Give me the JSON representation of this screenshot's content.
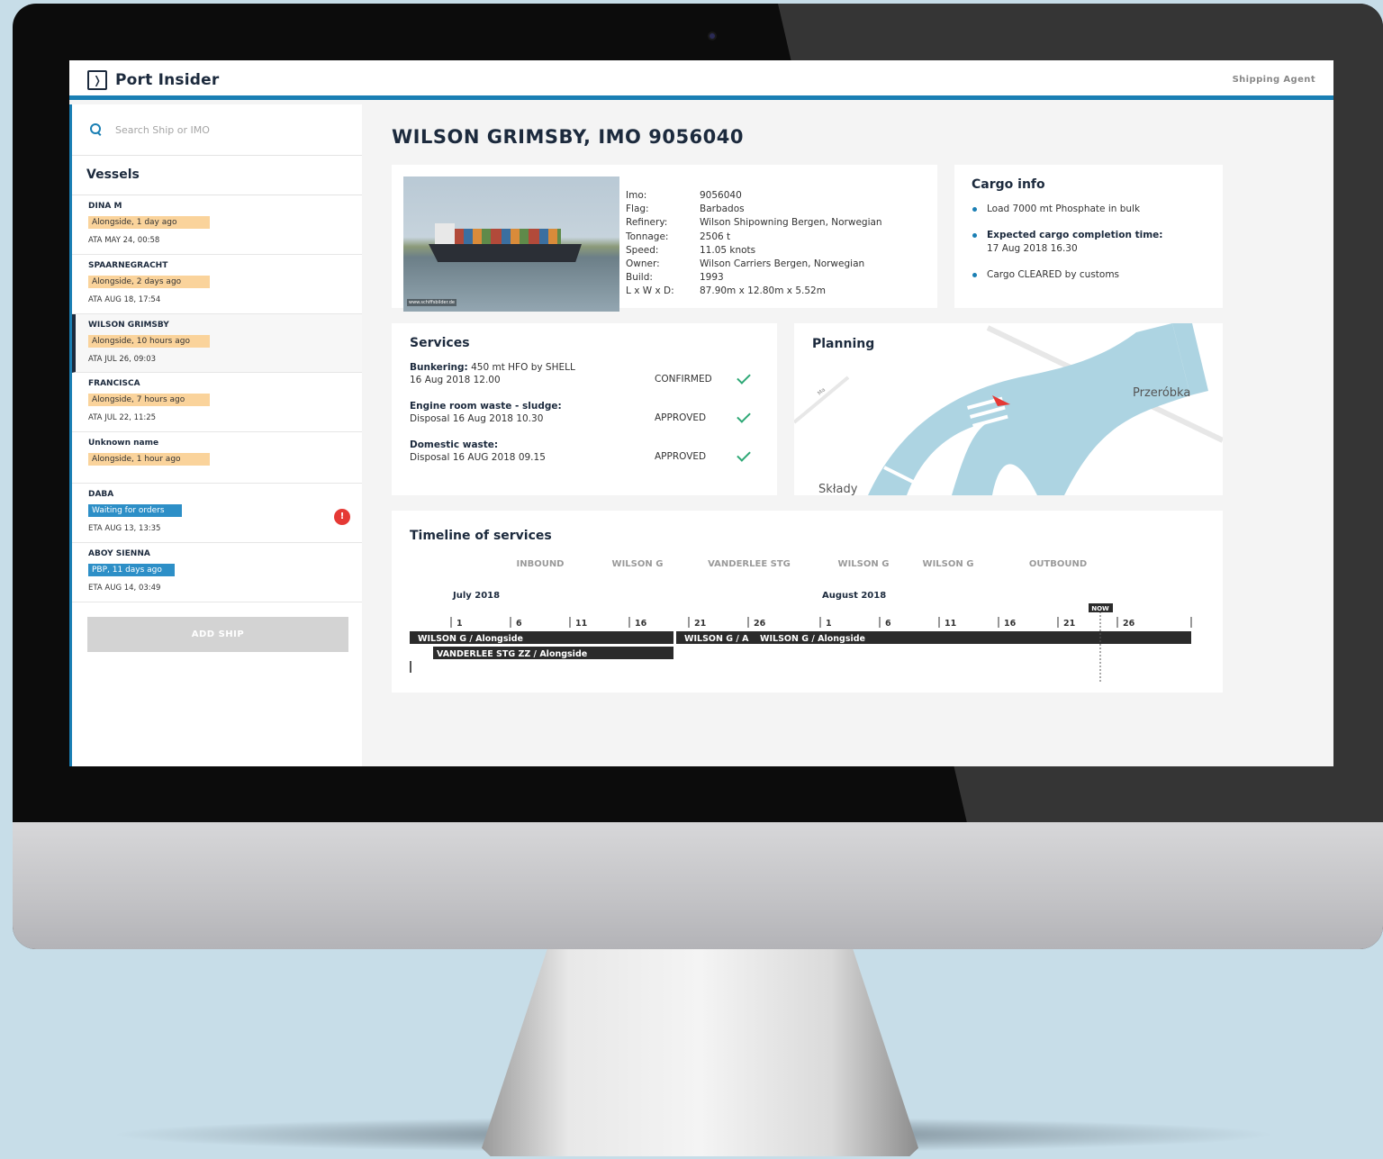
{
  "app": {
    "name": "Port Insider",
    "role": "Shipping Agent"
  },
  "search": {
    "placeholder": "Search Ship or IMO"
  },
  "sidebar": {
    "title": "Vessels",
    "vessels": [
      {
        "name": "DINA M",
        "status": "Alongside, 1 day ago",
        "time": "ATA MAY 24, 00:58"
      },
      {
        "name": "SPAARNEGRACHT",
        "status": "Alongside, 2 days ago",
        "time": "ATA AUG 18, 17:54"
      },
      {
        "name": "WILSON GRIMSBY",
        "status": "Alongside, 10 hours ago",
        "time": "ATA JUL 26, 09:03"
      },
      {
        "name": "FRANCISCA",
        "status": "Alongside, 7 hours ago",
        "time": "ATA JUL 22, 11:25"
      },
      {
        "name": "Unknown name",
        "status": "Alongside, 1 hour ago",
        "time": ""
      },
      {
        "name": "DABA",
        "status": "Waiting for orders",
        "time": "ETA AUG 13, 13:35",
        "alert": "!"
      },
      {
        "name": "ABOY SIENNA",
        "status": "PBP, 11 days ago",
        "time": "ETA AUG 14, 03:49"
      }
    ],
    "add_button": "ADD SHIP"
  },
  "ship": {
    "title": "WILSON GRIMSBY, IMO 9056040",
    "photo_caption": "www.schiffsbilder.de",
    "specs": [
      {
        "label": "Imo:",
        "value": "9056040"
      },
      {
        "label": "Flag:",
        "value": "Barbados"
      },
      {
        "label": "Refinery:",
        "value": "Wilson Shipowning Bergen, Norwegian"
      },
      {
        "label": "Tonnage:",
        "value": "2506 t"
      },
      {
        "label": "Speed:",
        "value": "11.05 knots"
      },
      {
        "label": "Owner:",
        "value": "Wilson Carriers Bergen, Norwegian"
      },
      {
        "label": "Build:",
        "value": "1993"
      },
      {
        "label": "L x W x D:",
        "value": "87.90m x 12.80m x 5.52m"
      }
    ]
  },
  "cargo": {
    "title": "Cargo info",
    "items": [
      {
        "text": "Load 7000 mt Phosphate in bulk"
      },
      {
        "bold": "Expected cargo completion time:",
        "text": "17 Aug 2018 16.30"
      },
      {
        "text": "Cargo CLEARED by customs"
      }
    ]
  },
  "services": {
    "title": "Services",
    "items": [
      {
        "bold": "Bunkering:",
        "text": "450 mt HFO by SHELL",
        "line2": "16 Aug 2018 12.00",
        "status": "CONFIRMED"
      },
      {
        "bold": "Engine room waste - sludge:",
        "text": "",
        "line2": "Disposal 16 Aug 2018 10.30",
        "status": "APPROVED"
      },
      {
        "bold": "Domestic waste:",
        "text": "",
        "line2": "Disposal 16 AUG 2018 09.15",
        "status": "APPROVED"
      }
    ]
  },
  "planning": {
    "title": "Planning",
    "labels": [
      "Przeróbka",
      "Składy",
      "Ma"
    ],
    "colors": {
      "water": "#add4e2",
      "road": "#e7e7e7",
      "marker": "#e53935"
    }
  },
  "timeline": {
    "title": "Timeline of services",
    "phases": [
      "INBOUND",
      "WILSON G",
      "VANDERLEE STG",
      "WILSON G",
      "WILSON G",
      "OUTBOUND"
    ],
    "months": [
      "July 2018",
      "August 2018"
    ],
    "ticks": [
      "1",
      "6",
      "11",
      "16",
      "21",
      "26",
      "1",
      "6",
      "11",
      "16",
      "21",
      "26"
    ],
    "now_label": "NOW",
    "bars": [
      {
        "label": "WILSON G / Alongside"
      },
      {
        "label": "WILSON G / A"
      },
      {
        "label": "WILSON G / Alongside"
      },
      {
        "label": "VANDERLEE STG ZZ / Alongside"
      }
    ]
  },
  "colors": {
    "accent": "#1a7fb4",
    "navy": "#1c2a3d",
    "badge_orange": "#fad39b",
    "badge_blue": "#2d8fc7",
    "alert": "#e53935",
    "confirm_green": "#2ea876"
  }
}
